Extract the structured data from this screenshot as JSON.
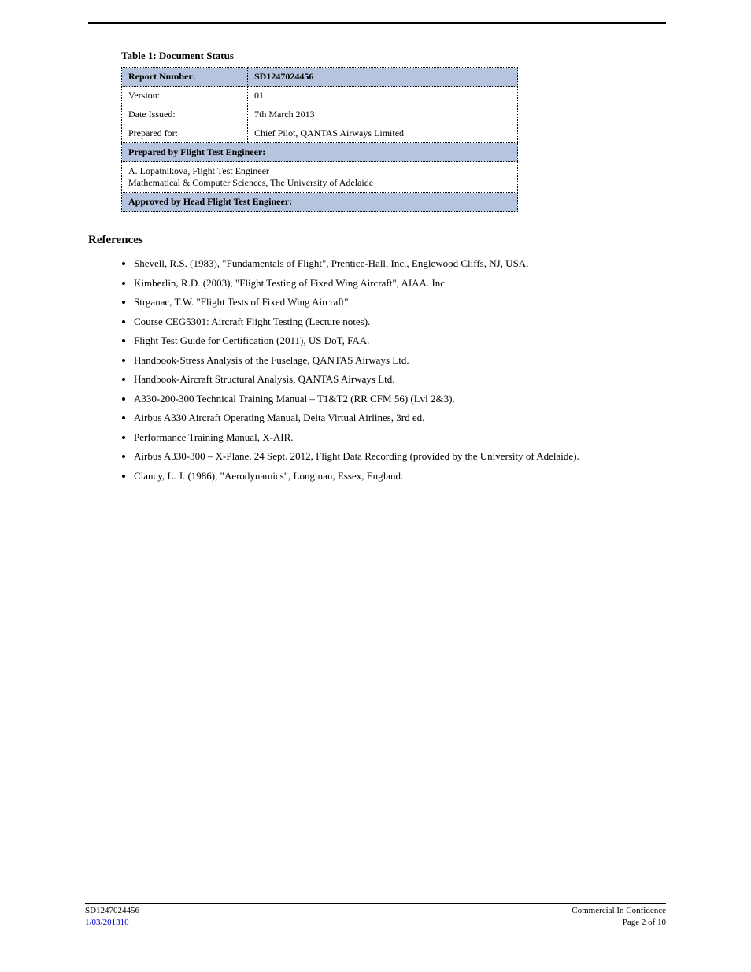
{
  "table": {
    "title": "Table 1: Document Status",
    "header_left": "Report Number:",
    "header_right": "SD1247024456",
    "rows": [
      {
        "label": "Version:",
        "value": "01"
      },
      {
        "label": "Date Issued:",
        "value": "7th March 2013"
      },
      {
        "label": "Prepared for:",
        "value": "Chief Pilot, QANTAS Airways Limited"
      }
    ],
    "section_a_title": "Prepared by Flight Test Engineer:",
    "section_a_name": "A. Lopatnikova, Flight Test Engineer",
    "section_a_org": "Mathematical & Computer Sciences, The University of Adelaide",
    "section_b_title": "Approved by Head Flight Test Engineer:",
    "section_b_empty": true
  },
  "references_heading": "References",
  "references": [
    "Shevell, R.S. (1983), \"Fundamentals of Flight\", Prentice-Hall, Inc., Englewood Cliffs, NJ, USA.",
    "Kimberlin, R.D. (2003), \"Flight Testing of Fixed Wing Aircraft\", AIAA. Inc.",
    "Strganac, T.W. \"Flight Tests of Fixed Wing Aircraft\".",
    "Course CEG5301: Aircraft Flight Testing (Lecture notes).",
    "Flight Test Guide for Certification (2011), US DoT, FAA.",
    "Handbook-Stress Analysis of the Fuselage, QANTAS Airways Ltd.",
    "Handbook-Aircraft Structural Analysis, QANTAS Airways Ltd.",
    "A330-200-300 Technical Training Manual – T1&T2 (RR   CFM 56) (Lvl 2&3).",
    "Airbus A330 Aircraft Operating Manual, Delta Virtual Airlines, 3rd ed.",
    "Performance Training Manual, X-AIR.",
    "Airbus A330-300 – X-Plane, 24 Sept. 2012, Flight Data Recording (provided by the University of Adelaide).",
    "Clancy, L. J. (1986), \"Aerodynamics\", Longman, Essex, England."
  ],
  "footer": {
    "left_line1": "SD1247024456",
    "left_link": "1/03/201310",
    "right_line1": "Commercial In Confidence",
    "right_line2": "Page 2 of 10"
  }
}
